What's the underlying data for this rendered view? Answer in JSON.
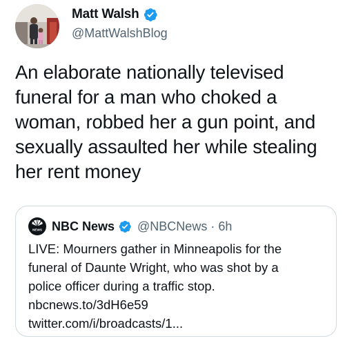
{
  "author": {
    "name": "Matt Walsh",
    "handle": "@MattWalshBlog",
    "verified_icon": "verified-badge-icon",
    "avatar_icon": "profile-photo"
  },
  "tweet": {
    "lines": [
      "An elaborate nationally televised",
      "funeral for a man who choked a",
      "woman, robbed her a gun point, and",
      "sexually assaulted her while stealing",
      "her rent money"
    ]
  },
  "quoted": {
    "name": "NBC News",
    "handle": "@NBCNews",
    "separator": "·",
    "time": "6h",
    "logo_icon": "nbc-peacock-logo",
    "logo_label": "NEWS",
    "lines": [
      "LIVE: Mourners gather in Minneapolis for the",
      "funeral of Daunte Wright, who was shot by a",
      "police officer during a traffic stop.",
      "nbcnews.to/3dH6e59",
      "twitter.com/i/broadcasts/1..."
    ]
  },
  "colors": {
    "verified": "#1d9bf0",
    "secondary_text": "#536471",
    "border": "#cfd9de"
  }
}
